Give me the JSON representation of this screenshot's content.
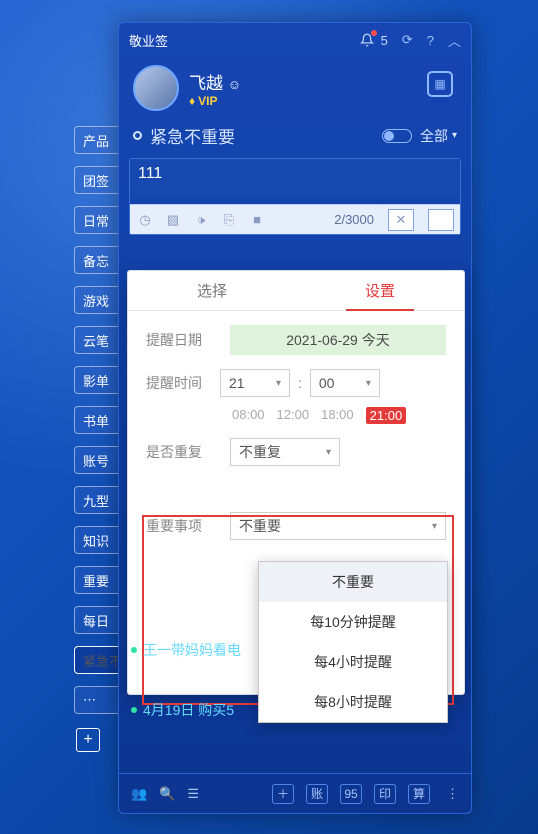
{
  "titlebar": {
    "brand": "敬业签",
    "notif_count": "5"
  },
  "profile": {
    "name": "飞越",
    "vip": "VIP"
  },
  "category": {
    "name": "紧急不重要",
    "all": "全部"
  },
  "editor": {
    "text": "111",
    "counter": "2/3000"
  },
  "side": {
    "items": [
      "产品",
      "团签",
      "日常",
      "备忘",
      "游戏",
      "云笔",
      "影单",
      "书单",
      "账号",
      "九型",
      "知识",
      "重要",
      "每日",
      "紧急不重要",
      "⋯"
    ],
    "add": "+"
  },
  "popup": {
    "tabs": {
      "select": "选择",
      "settings": "设置"
    },
    "date": {
      "label": "提醒日期",
      "value": "2021-06-29 今天"
    },
    "time": {
      "label": "提醒时间",
      "hour": "21",
      "minute": "00",
      "colon": ":"
    },
    "chips": [
      "08:00",
      "12:00",
      "18:00",
      "21:00"
    ],
    "repeat": {
      "label": "是否重复",
      "value": "不重复"
    },
    "importance": {
      "label": "重要事项",
      "value": "不重要",
      "options": [
        "不重要",
        "每10分钟提醒",
        "每4小时提醒",
        "每8小时提醒"
      ]
    }
  },
  "notes": {
    "a": "王一带妈妈看电",
    "b": "4月19日 购买5"
  },
  "footer": {
    "a": "账",
    "b": "95",
    "c": "印",
    "d": "算"
  }
}
